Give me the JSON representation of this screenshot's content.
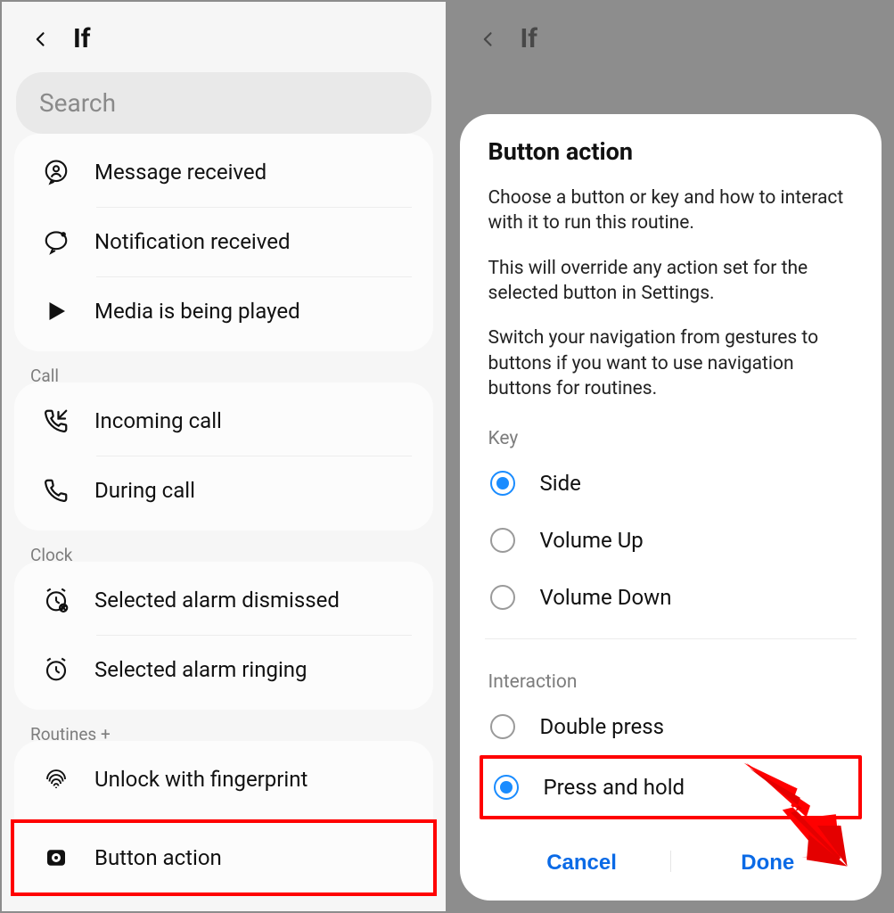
{
  "left": {
    "header_title": "If",
    "search_placeholder": "Search",
    "groups": {
      "top": {
        "items": [
          {
            "label": "Message received"
          },
          {
            "label": "Notification received"
          },
          {
            "label": "Media is being played"
          }
        ]
      },
      "call": {
        "label": "Call",
        "items": [
          {
            "label": "Incoming call"
          },
          {
            "label": "During call"
          }
        ]
      },
      "clock": {
        "label": "Clock",
        "items": [
          {
            "label": "Selected alarm dismissed"
          },
          {
            "label": "Selected alarm ringing"
          }
        ]
      },
      "routines": {
        "label": "Routines +",
        "items": [
          {
            "label": "Unlock with fingerprint"
          },
          {
            "label": "Button action"
          }
        ]
      }
    }
  },
  "right": {
    "header_title": "If",
    "sheet": {
      "title": "Button action",
      "desc1": "Choose a button or key and how to interact with it to run this routine.",
      "desc2": "This will override any action set for the selected button in Settings.",
      "desc3": "Switch your navigation from gestures to buttons if you want to use navigation buttons for routines.",
      "key_label": "Key",
      "keys": [
        {
          "label": "Side",
          "checked": true
        },
        {
          "label": "Volume Up",
          "checked": false
        },
        {
          "label": "Volume Down",
          "checked": false
        }
      ],
      "interaction_label": "Interaction",
      "interactions": [
        {
          "label": "Double press",
          "checked": false
        },
        {
          "label": "Press and hold",
          "checked": true
        }
      ],
      "cancel": "Cancel",
      "done": "Done"
    }
  }
}
